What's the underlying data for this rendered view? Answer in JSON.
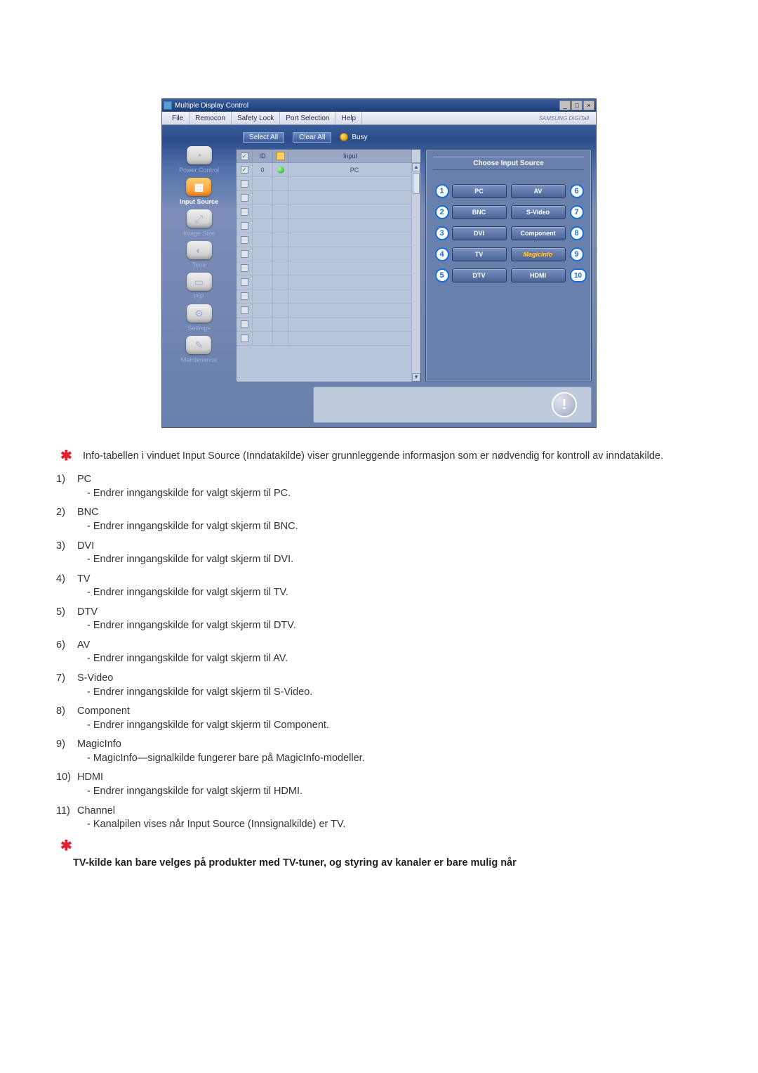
{
  "app": {
    "title": "Multiple Display Control",
    "menu": [
      "File",
      "Remocon",
      "Safety Lock",
      "Port Selection",
      "Help"
    ],
    "brand": "SAMSUNG DIGITall"
  },
  "sidebar": {
    "items": [
      {
        "label": "Power Control",
        "active": false
      },
      {
        "label": "Input Source",
        "active": true
      },
      {
        "label": "Image Size",
        "active": false
      },
      {
        "label": "Time",
        "active": false
      },
      {
        "label": "PIP",
        "active": false
      },
      {
        "label": "Settings",
        "active": false
      },
      {
        "label": "Maintenance",
        "active": false
      }
    ]
  },
  "toolbar": {
    "select_all": "Select All",
    "clear_all": "Clear All",
    "busy": "Busy"
  },
  "table": {
    "headers": {
      "id": "ID",
      "input": "Input"
    },
    "rows": [
      {
        "checked": true,
        "id": "0",
        "status": "on",
        "input": "PC"
      },
      {
        "checked": false,
        "id": "",
        "status": "",
        "input": ""
      },
      {
        "checked": false
      },
      {
        "checked": false
      },
      {
        "checked": false
      },
      {
        "checked": false
      },
      {
        "checked": false
      },
      {
        "checked": false
      },
      {
        "checked": false
      },
      {
        "checked": false
      },
      {
        "checked": false
      },
      {
        "checked": false
      },
      {
        "checked": false
      }
    ]
  },
  "source_panel": {
    "title": "Choose Input Source",
    "left": [
      {
        "n": "1",
        "label": "PC"
      },
      {
        "n": "2",
        "label": "BNC"
      },
      {
        "n": "3",
        "label": "DVI"
      },
      {
        "n": "4",
        "label": "TV"
      },
      {
        "n": "5",
        "label": "DTV"
      }
    ],
    "right": [
      {
        "n": "6",
        "label": "AV"
      },
      {
        "n": "7",
        "label": "S-Video"
      },
      {
        "n": "8",
        "label": "Component"
      },
      {
        "n": "9",
        "label": "MagicInfo",
        "magic": true
      },
      {
        "n": "10",
        "label": "HDMI"
      }
    ]
  },
  "notes": {
    "lead": "Info-tabellen i vinduet Input Source (Inndatakilde) viser grunnleggende informasjon som er nødvendig for kontroll av inndatakilde.",
    "items": [
      {
        "n": "1)",
        "title": "PC",
        "desc": "- Endrer inngangskilde for valgt skjerm til PC."
      },
      {
        "n": "2)",
        "title": "BNC",
        "desc": "- Endrer inngangskilde for valgt skjerm til BNC."
      },
      {
        "n": "3)",
        "title": "DVI",
        "desc": "- Endrer inngangskilde for valgt skjerm til DVI."
      },
      {
        "n": "4)",
        "title": "TV",
        "desc": "- Endrer inngangskilde for valgt skjerm til TV."
      },
      {
        "n": "5)",
        "title": "DTV",
        "desc": "- Endrer inngangskilde for valgt skjerm til DTV."
      },
      {
        "n": "6)",
        "title": "AV",
        "desc": "- Endrer inngangskilde for valgt skjerm til AV."
      },
      {
        "n": "7)",
        "title": "S-Video",
        "desc": "- Endrer inngangskilde for valgt skjerm til S-Video."
      },
      {
        "n": "8)",
        "title": "Component",
        "desc": "- Endrer inngangskilde for valgt skjerm til Component."
      },
      {
        "n": "9)",
        "title": "MagicInfo",
        "desc": "- MagicInfo—signalkilde fungerer bare på MagicInfo-modeller."
      },
      {
        "n": "10)",
        "title": "HDMI",
        "desc": "- Endrer inngangskilde for valgt skjerm til HDMI."
      },
      {
        "n": "11)",
        "title": "Channel",
        "desc": "- Kanalpilen vises når Input Source (Innsignalkilde) er TV."
      }
    ],
    "footnote": "TV-kilde kan bare velges på produkter med TV-tuner, og styring av kanaler er bare mulig når"
  }
}
